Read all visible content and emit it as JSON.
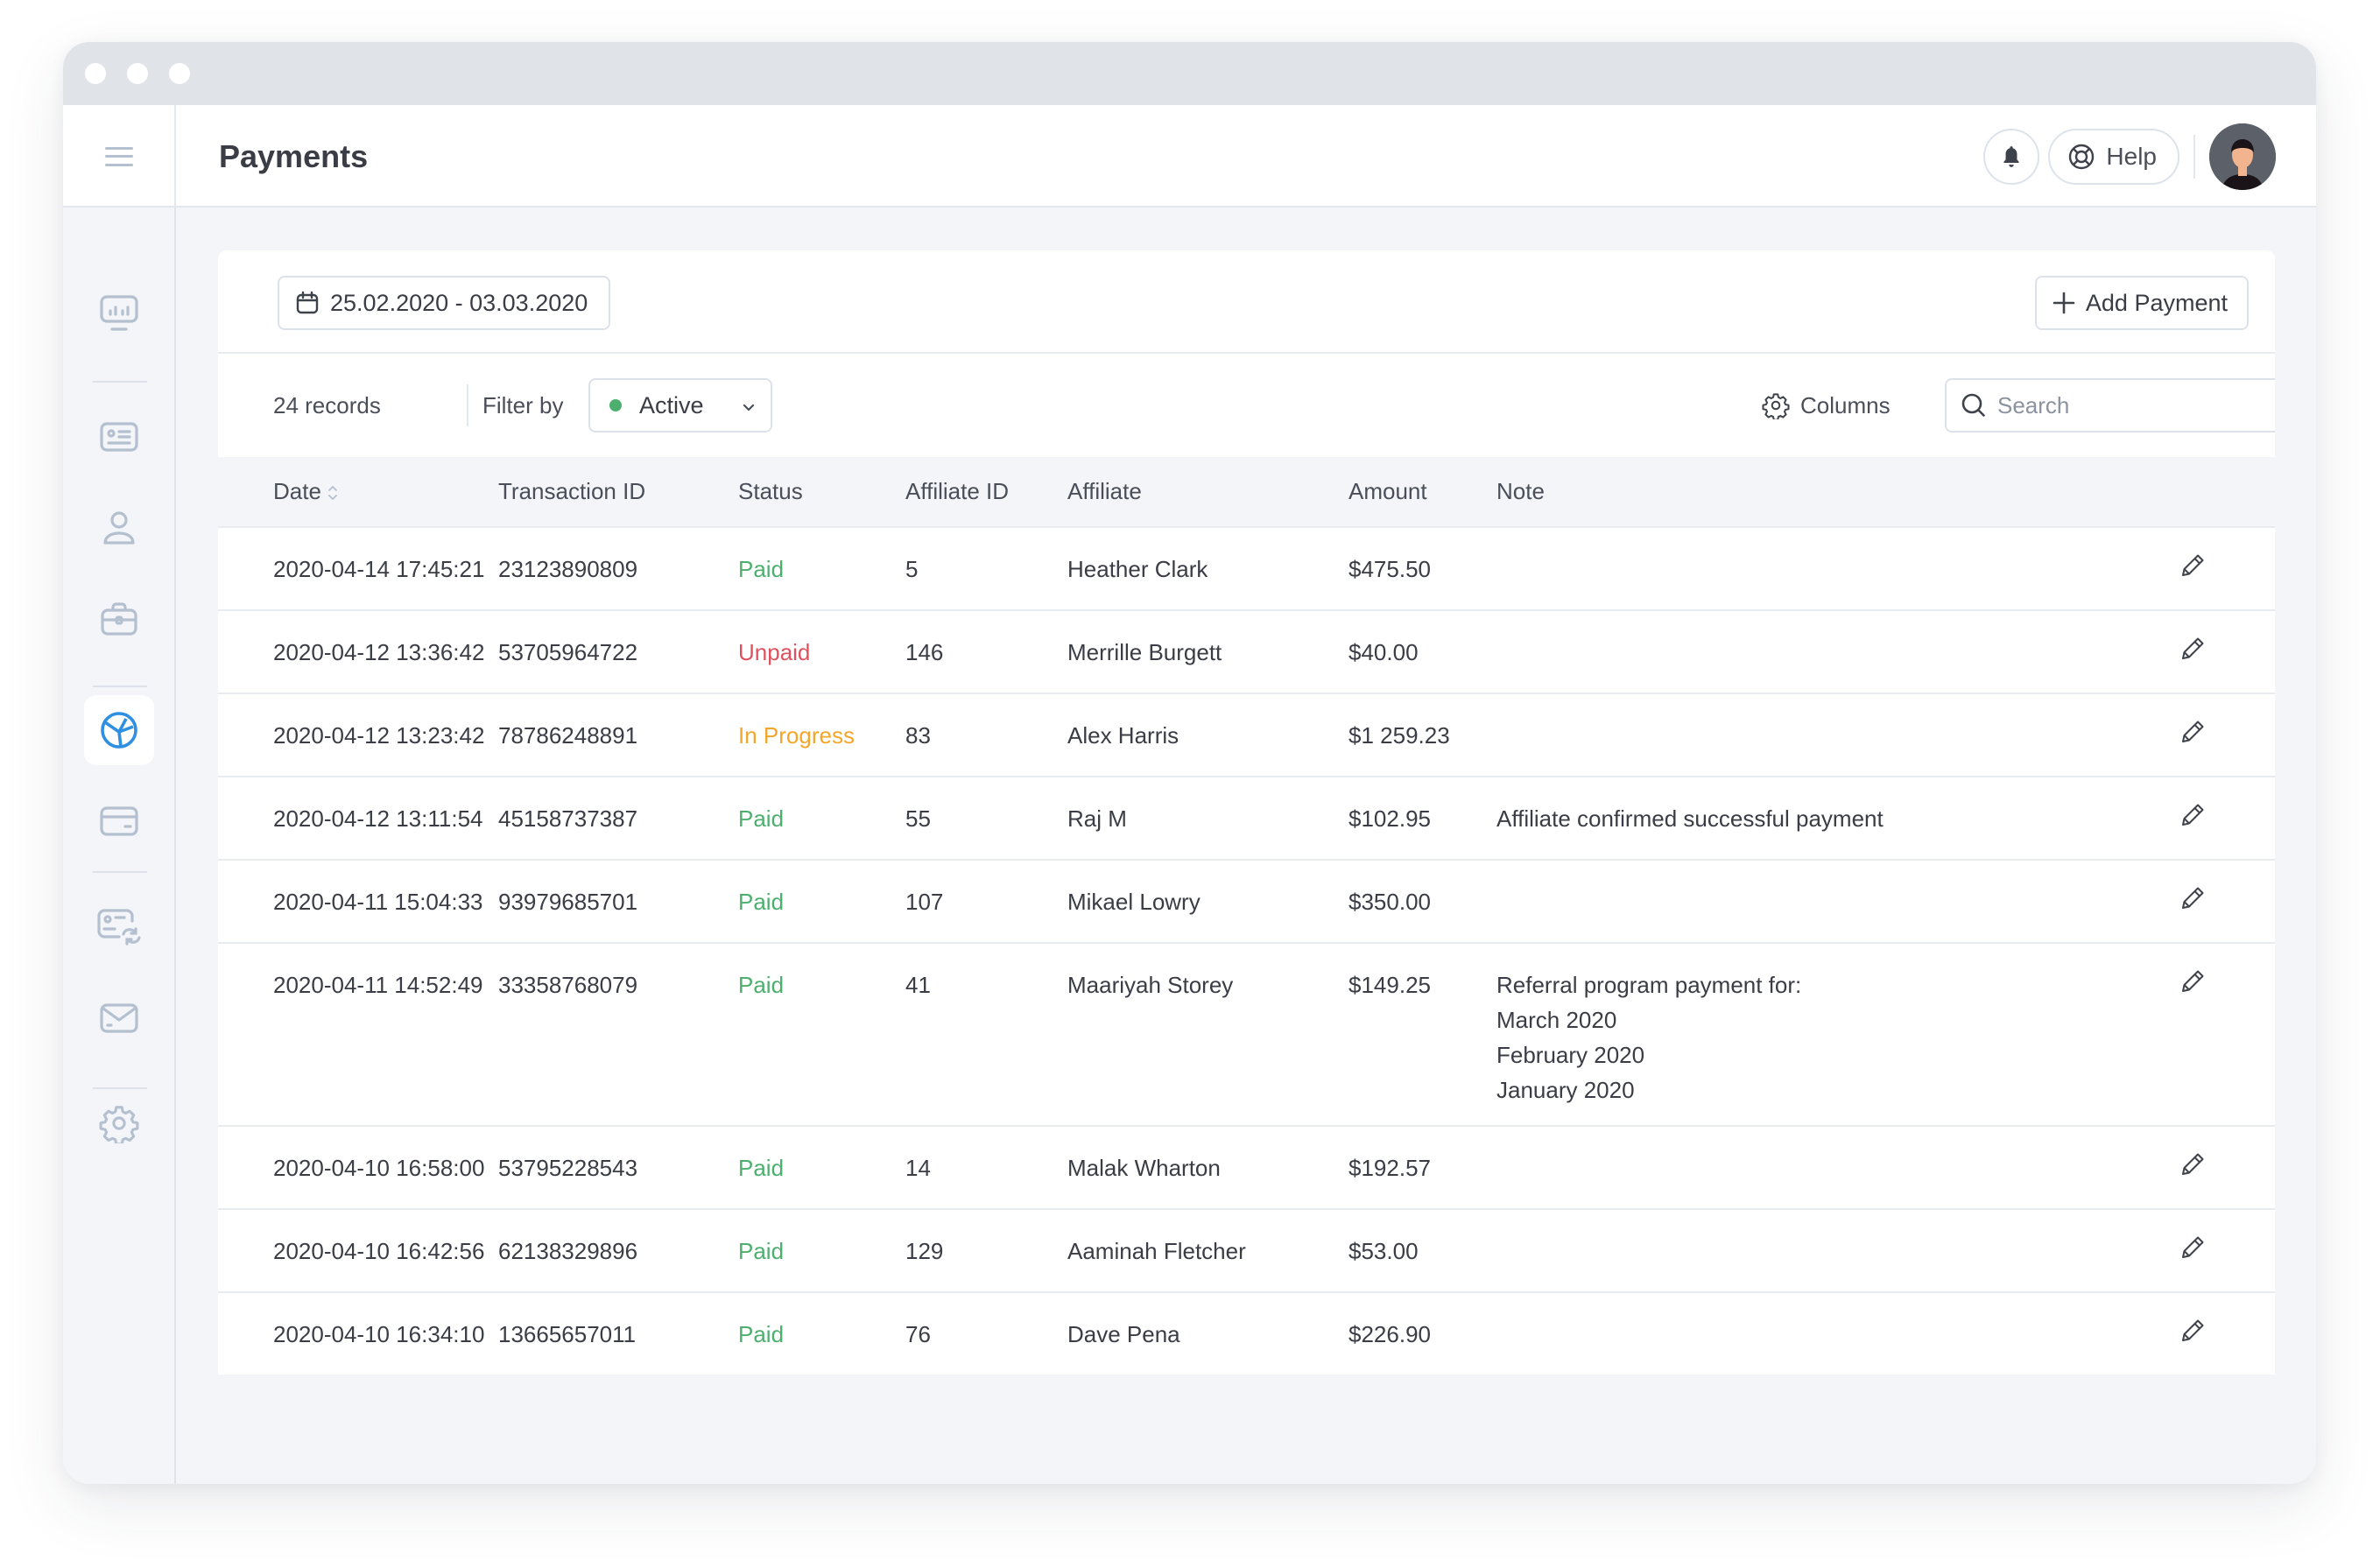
{
  "window": {
    "title_dots": 3
  },
  "header": {
    "title": "Payments",
    "help_label": "Help",
    "icons": {
      "menu": "hamburger-icon",
      "notifications": "bell-icon",
      "help": "lifebuoy-icon",
      "avatar": "user-avatar"
    }
  },
  "sidebar": {
    "items": [
      {
        "icon": "dashboard-monitor-icon",
        "active": false
      },
      {
        "icon": "id-card-icon",
        "active": false
      },
      {
        "icon": "user-icon",
        "active": false
      },
      {
        "icon": "briefcase-icon",
        "active": false
      },
      {
        "icon": "pie-chart-icon",
        "active": true
      },
      {
        "icon": "credit-card-icon",
        "active": false
      },
      {
        "icon": "card-sync-icon",
        "active": false
      },
      {
        "icon": "mail-icon",
        "active": false
      },
      {
        "icon": "settings-gear-icon",
        "active": false
      }
    ]
  },
  "filters": {
    "date_range": "25.02.2020 - 03.03.2020",
    "add_payment_label": "Add Payment",
    "records_count": "24 records",
    "filter_by_label": "Filter by",
    "filter_value": "Active",
    "columns_label": "Columns",
    "search_placeholder": "Search",
    "search_value": ""
  },
  "colors": {
    "accent": "#2f8fe0",
    "paid": "#4caf6e",
    "unpaid": "#e0505f",
    "in_progress": "#f4a62a",
    "active_dot": "#4caf6e",
    "sidebar_icon": "#b4c0cf"
  },
  "table": {
    "columns": [
      "Date",
      "Transaction ID",
      "Status",
      "Affiliate ID",
      "Affiliate",
      "Amount",
      "Note"
    ],
    "sortable_column": "Date",
    "rows": [
      {
        "date": "2020-04-14 17:45:21",
        "transaction_id": "23123890809",
        "status": "Paid",
        "status_key": "paid",
        "affiliate_id": "5",
        "affiliate": "Heather Clark",
        "amount": "$475.50",
        "note": []
      },
      {
        "date": "2020-04-12 13:36:42",
        "transaction_id": "53705964722",
        "status": "Unpaid",
        "status_key": "unpaid",
        "affiliate_id": "146",
        "affiliate": "Merrille Burgett",
        "amount": "$40.00",
        "note": []
      },
      {
        "date": "2020-04-12 13:23:42",
        "transaction_id": "78786248891",
        "status": "In Progress",
        "status_key": "in_progress",
        "affiliate_id": "83",
        "affiliate": "Alex Harris",
        "amount": "$1 259.23",
        "note": []
      },
      {
        "date": "2020-04-12 13:11:54",
        "transaction_id": "45158737387",
        "status": "Paid",
        "status_key": "paid",
        "affiliate_id": "55",
        "affiliate": "Raj M",
        "amount": "$102.95",
        "note": [
          "Affiliate confirmed successful payment"
        ]
      },
      {
        "date": "2020-04-11 15:04:33",
        "transaction_id": "93979685701",
        "status": "Paid",
        "status_key": "paid",
        "affiliate_id": "107",
        "affiliate": "Mikael Lowry",
        "amount": "$350.00",
        "note": []
      },
      {
        "date": "2020-04-11 14:52:49",
        "transaction_id": "33358768079",
        "status": "Paid",
        "status_key": "paid",
        "affiliate_id": "41",
        "affiliate": "Maariyah Storey",
        "amount": "$149.25",
        "note": [
          "Referral program payment for:",
          "March 2020",
          "February 2020",
          "January 2020"
        ]
      },
      {
        "date": "2020-04-10 16:58:00",
        "transaction_id": "53795228543",
        "status": "Paid",
        "status_key": "paid",
        "affiliate_id": "14",
        "affiliate": "Malak Wharton",
        "amount": "$192.57",
        "note": []
      },
      {
        "date": "2020-04-10 16:42:56",
        "transaction_id": "62138329896",
        "status": "Paid",
        "status_key": "paid",
        "affiliate_id": "129",
        "affiliate": "Aaminah Fletcher",
        "amount": "$53.00",
        "note": []
      },
      {
        "date": "2020-04-10 16:34:10",
        "transaction_id": "13665657011",
        "status": "Paid",
        "status_key": "paid",
        "affiliate_id": "76",
        "affiliate": "Dave Pena",
        "amount": "$226.90",
        "note": []
      }
    ]
  }
}
